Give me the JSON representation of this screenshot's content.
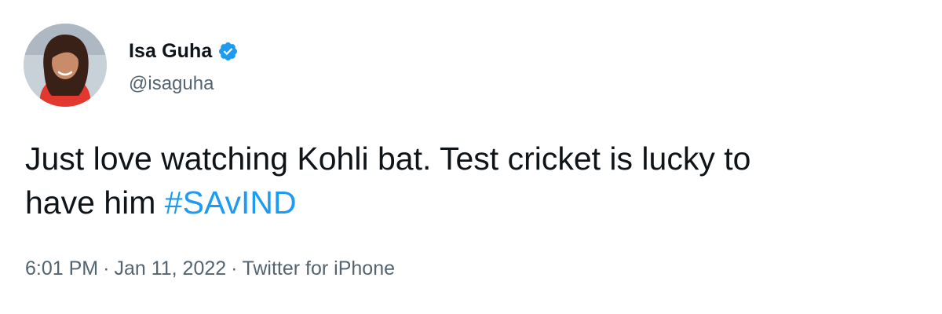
{
  "author": {
    "display_name": "Isa Guha",
    "handle": "@isaguha",
    "verified": true,
    "verified_icon": "verified-badge-icon",
    "avatar_icon": "profile-photo"
  },
  "tweet": {
    "line1": "Just love watching Kohli bat. Test cricket is lucky to",
    "line2_prefix": "have him ",
    "hashtag": "#SAvIND"
  },
  "meta": {
    "time": "6:01 PM",
    "separator": "·",
    "date": "Jan 11, 2022",
    "source": "Twitter for iPhone"
  },
  "colors": {
    "text": "#0f1419",
    "secondary": "#536471",
    "link": "#1d9bf0",
    "background": "#ffffff"
  }
}
